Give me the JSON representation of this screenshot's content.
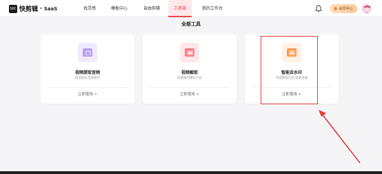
{
  "header": {
    "logo_mark": "SOC",
    "app_name": "快剪辑",
    "separator": "•",
    "app_suffix": "SaaS",
    "nav": [
      {
        "label": "找灵感"
      },
      {
        "label": "模板中心"
      },
      {
        "label": "自由剪辑"
      },
      {
        "label": "工具箱",
        "active": true
      },
      {
        "label": "我的工作台"
      }
    ],
    "vip_label": "会员中心",
    "bell_icon": "bell-icon"
  },
  "main": {
    "section_title": "全部工具",
    "tools": [
      {
        "title": "视频提取音频",
        "desc": "提取配乐无损保存",
        "action": "立即使用 >",
        "icon": "audio-extract-icon",
        "color": "#b79cf5"
      },
      {
        "title": "视频截取",
        "desc": "快速保存精彩片段",
        "action": "立即使用 >",
        "icon": "video-cut-icon",
        "color": "#ff7a87"
      },
      {
        "title": "智能去水印",
        "desc": "丹度精准识别,智能处理",
        "action": "立即使用 >",
        "icon": "watermark-remove-icon",
        "color": "#ff9a52"
      }
    ]
  },
  "annotation": {
    "color": "#e53935"
  }
}
